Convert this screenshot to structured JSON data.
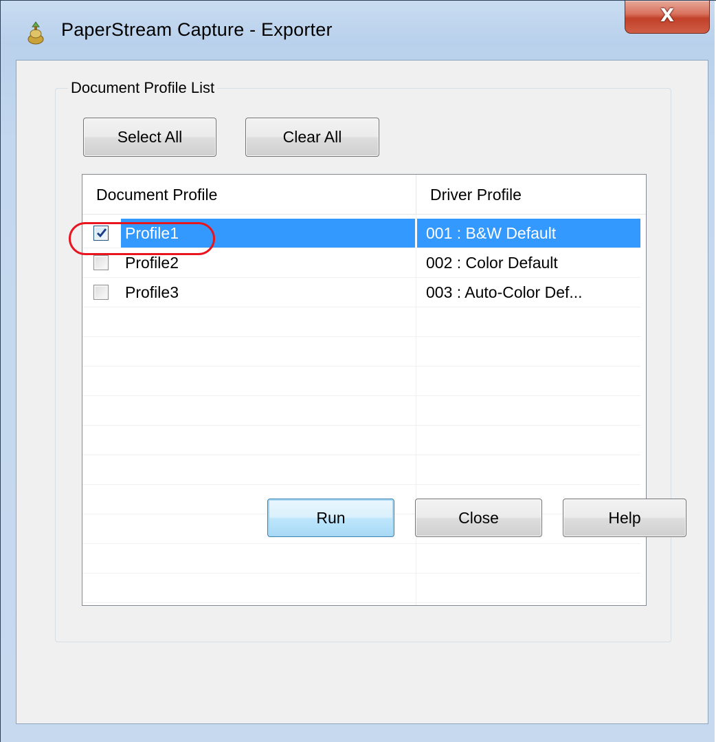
{
  "window": {
    "title": "PaperStream Capture - Exporter",
    "close_glyph": "X",
    "icon": "paperstream-app-icon"
  },
  "group": {
    "legend": "Document Profile List"
  },
  "buttons": {
    "select_all": "Select All",
    "clear_all": "Clear All",
    "run": "Run",
    "close": "Close",
    "help": "Help"
  },
  "list": {
    "columns": [
      "Document Profile",
      "Driver Profile"
    ],
    "rows": [
      {
        "name": "Profile1",
        "driver": "001 : B&W Default",
        "checked": true,
        "selected": true
      },
      {
        "name": "Profile2",
        "driver": "002 : Color Default",
        "checked": false,
        "selected": false
      },
      {
        "name": "Profile3",
        "driver": "003 : Auto-Color Def...",
        "checked": false,
        "selected": false
      }
    ]
  },
  "colors": {
    "selection": "#3399ff",
    "highlight_ring": "#e8141e",
    "close_button": "#c2412a"
  }
}
